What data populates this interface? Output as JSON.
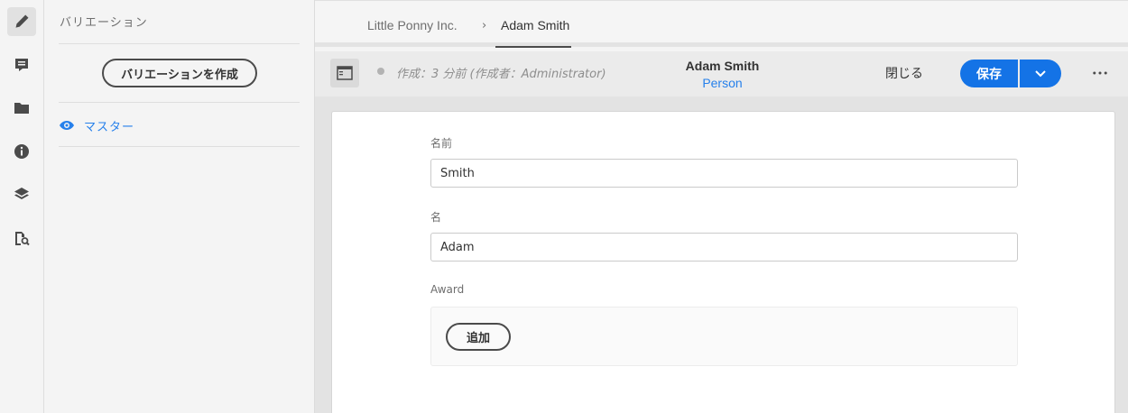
{
  "rail": {
    "items": [
      {
        "icon": "pencil-icon"
      },
      {
        "icon": "comment-icon"
      },
      {
        "icon": "folder-icon"
      },
      {
        "icon": "info-icon"
      },
      {
        "icon": "layers-icon"
      },
      {
        "icon": "find-reference-icon"
      }
    ]
  },
  "panel": {
    "title": "バリエーション",
    "create_button": "バリエーションを作成",
    "master_label": "マスター"
  },
  "breadcrumb": {
    "parent": "Little Ponny Inc.",
    "current": "Adam Smith"
  },
  "actionbar": {
    "status": "作成：3 分前 (作成者：Administrator)",
    "title": "Adam Smith",
    "model": "Person",
    "close_label": "閉じる",
    "save_label": "保存"
  },
  "form": {
    "last_name_label": "名前",
    "last_name_value": "Smith",
    "first_name_label": "名",
    "first_name_value": "Adam",
    "award_label": "Award",
    "add_label": "追加"
  },
  "colors": {
    "accent": "#1473e6",
    "link": "#2680eb"
  }
}
